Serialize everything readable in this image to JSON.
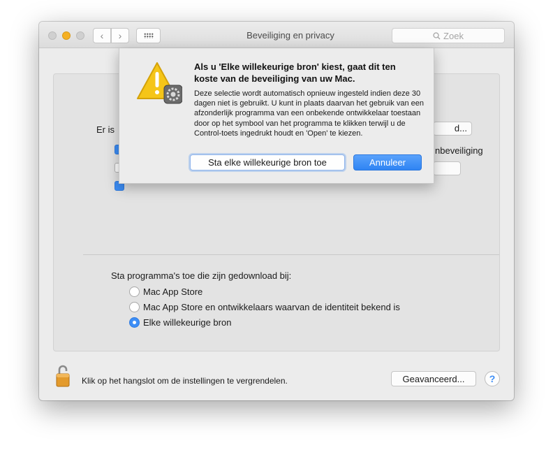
{
  "window": {
    "title": "Beveiliging en privacy",
    "search_placeholder": "Zoek",
    "nav_back": "‹",
    "nav_forward": "›"
  },
  "background_panel": {
    "partial_label_1": "Er is ",
    "partial_button_1": "d...",
    "partial_checkbox_label": "nbeveiliging",
    "checkboxes": [
      {
        "checked": true
      },
      {
        "checked": false
      },
      {
        "checked": true
      }
    ]
  },
  "downloads": {
    "label": "Sta programma's toe die zijn gedownload bij:",
    "options": [
      {
        "label": "Mac App Store",
        "selected": false
      },
      {
        "label": "Mac App Store en ontwikkelaars waarvan de identiteit bekend is",
        "selected": false
      },
      {
        "label": "Elke willekeurige bron",
        "selected": true
      }
    ]
  },
  "footer": {
    "lock_text": "Klik op het hangslot om de instellingen te vergrendelen.",
    "advanced_button": "Geavanceerd...",
    "help_button": "?"
  },
  "sheet": {
    "title": "Als u 'Elke willekeurige bron' kiest, gaat dit ten koste van de beveiliging van uw Mac.",
    "body": "Deze selectie wordt automatisch opnieuw ingesteld indien deze 30 dagen niet is gebruikt. U kunt in plaats daarvan het gebruik van een afzonderlijk programma van een onbekende ontwikkelaar toestaan door op het symbool van het programma te klikken terwijl u de Control-toets ingedrukt houdt en 'Open' te kiezen.",
    "allow_button": "Sta elke willekeurige bron toe",
    "cancel_button": "Annuleer"
  },
  "colors": {
    "accent": "#3d8ef6",
    "warning_yellow": "#f5c518",
    "lock_orange": "#e39a2c"
  }
}
